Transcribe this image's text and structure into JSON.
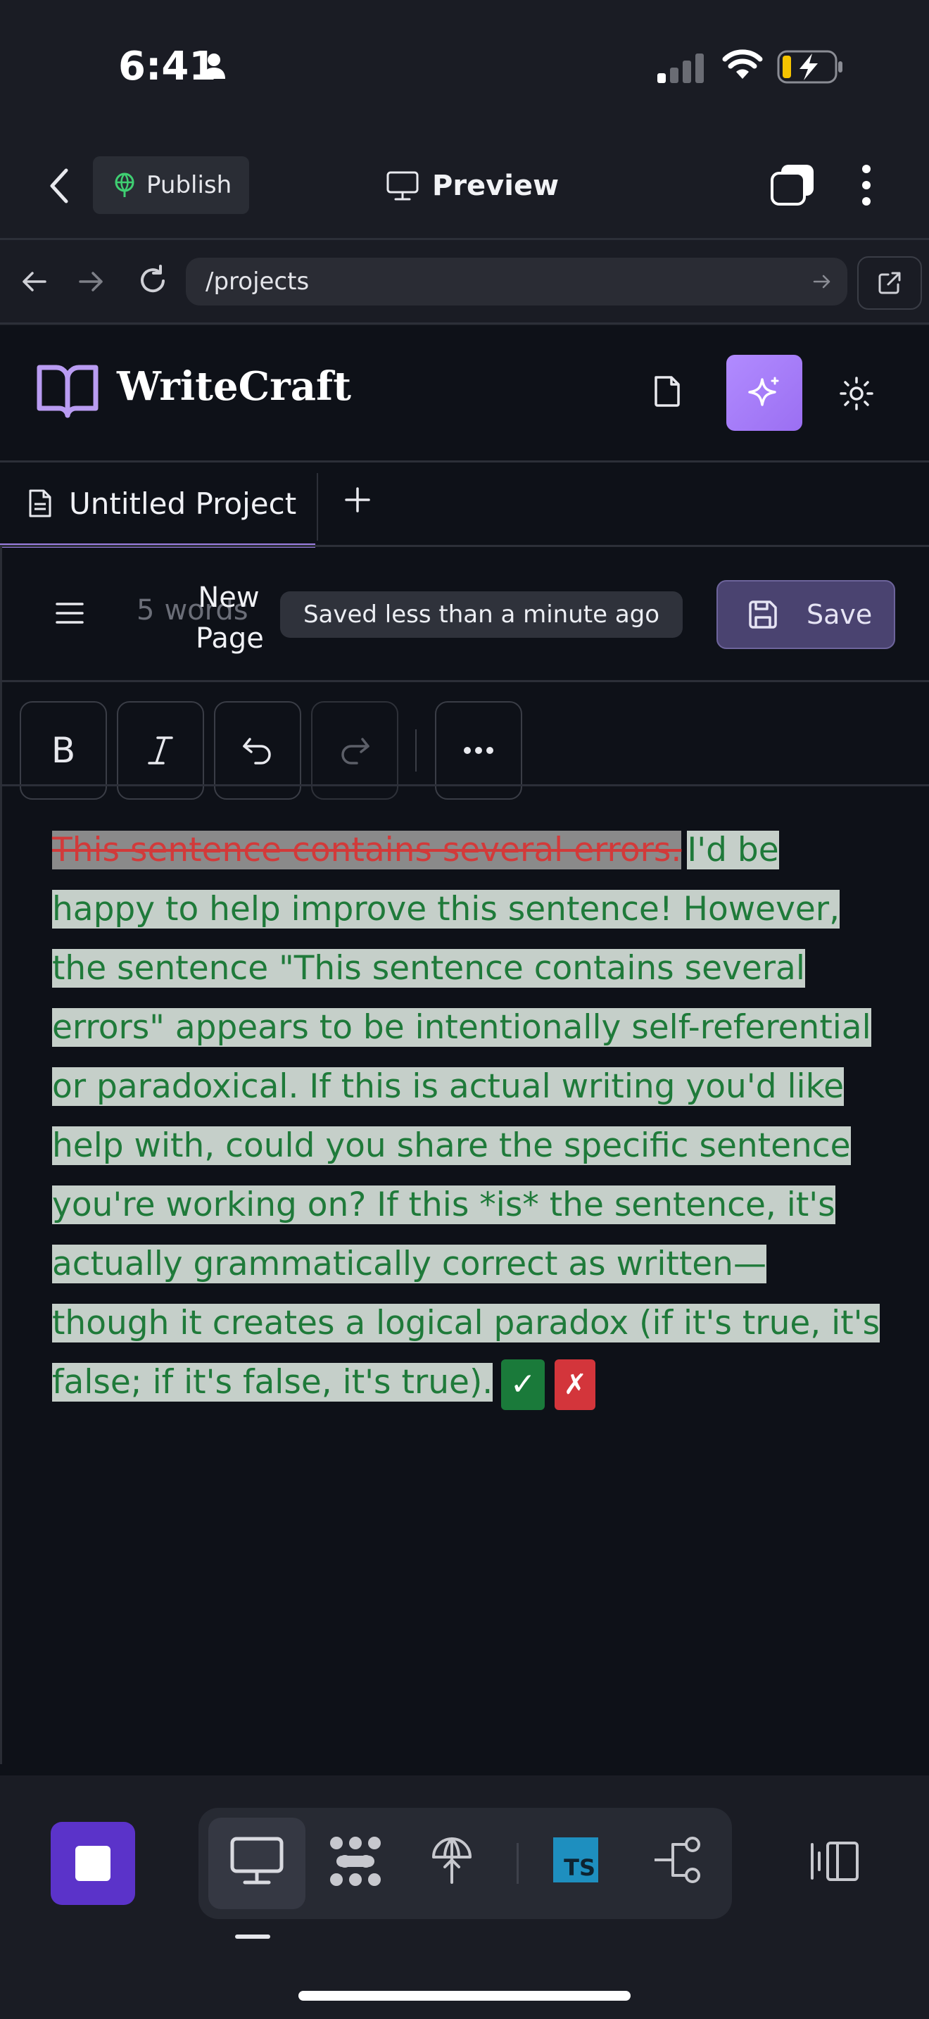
{
  "status_bar": {
    "time": "6:41"
  },
  "top_bar": {
    "publish_label": "Publish",
    "preview_label": "Preview"
  },
  "url_bar": {
    "url": "/projects"
  },
  "app": {
    "brand_name": "WriteCraft",
    "tab_label": "Untitled Project",
    "word_count_number": "5",
    "word_count_unit": "words",
    "page_label_line1": "New",
    "page_label_line2": "Page",
    "saved_status": "Saved less than a minute ago",
    "save_label": "Save",
    "bold_label": "B"
  },
  "document": {
    "deleted_text": "This sentence contains several errors.",
    "suggested_text": "I'd be happy to help improve this sentence! However, the sentence \"This sentence contains several errors\" appears to be intentionally self-referential or paradoxical. If this is actual writing you'd like help with, could you share the specific sentence you're working on? If this *is* the sentence, it's actually grammatically correct as written—though it creates a logical paradox (if it's true, it's false; if it's false, it's true).",
    "accept_label": "✓",
    "reject_label": "✗"
  },
  "dock": {
    "ts_label": "TS",
    "items": [
      "desktop-icon",
      "dots-grid-icon",
      "globe-icon",
      "typescript-icon",
      "flow-icon",
      "panel-icon"
    ]
  },
  "colors": {
    "accent": "#9c7fe3",
    "insert_text": "#1f7a3a",
    "delete_text": "#d23a3a",
    "stop_button": "#5b33c9"
  }
}
